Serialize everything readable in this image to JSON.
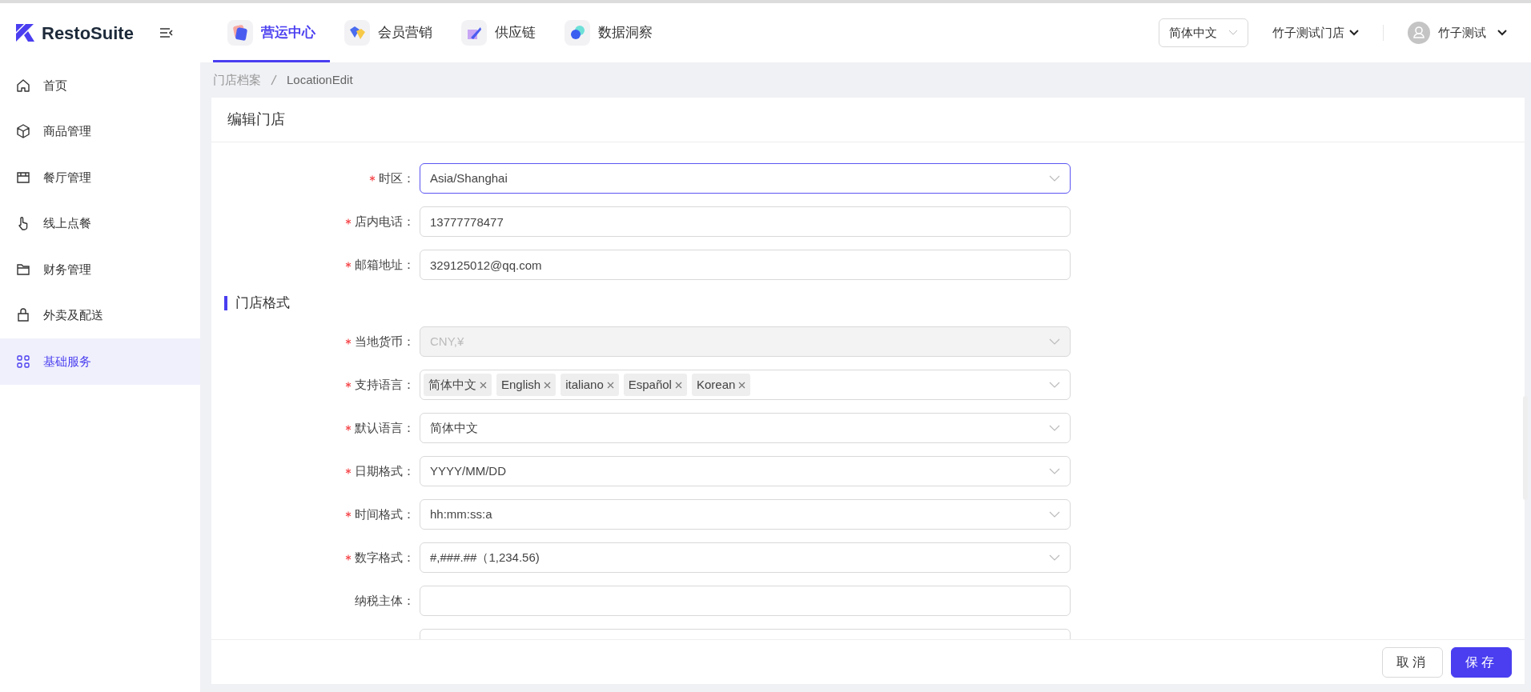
{
  "logo": {
    "text": "RestoSuite"
  },
  "top_tabs": [
    {
      "label": "营运中心",
      "selected": true
    },
    {
      "label": "会员营销",
      "selected": false
    },
    {
      "label": "供应链",
      "selected": false
    },
    {
      "label": "数据洞察",
      "selected": false
    }
  ],
  "language_select": {
    "value": "简体中文"
  },
  "store_menu": {
    "label": "竹子测试门店"
  },
  "user_menu": {
    "label": "竹子测试"
  },
  "sidebar": {
    "items": [
      {
        "label": "首页",
        "selected": false
      },
      {
        "label": "商品管理",
        "selected": false
      },
      {
        "label": "餐厅管理",
        "selected": false
      },
      {
        "label": "线上点餐",
        "selected": false
      },
      {
        "label": "财务管理",
        "selected": false
      },
      {
        "label": "外卖及配送",
        "selected": false
      },
      {
        "label": "基础服务",
        "selected": true
      }
    ]
  },
  "breadcrumb": [
    {
      "label": "门店档案"
    },
    {
      "label": "LocationEdit"
    }
  ],
  "card": {
    "title": "编辑门店",
    "rows": [
      {
        "kind": "select",
        "label": "时区：",
        "required": true,
        "value": "Asia/Shanghai",
        "focused": true,
        "disabled": false
      },
      {
        "kind": "input",
        "label": "店内电话：",
        "required": true,
        "value": "13777778477"
      },
      {
        "kind": "input",
        "label": "邮箱地址：",
        "required": true,
        "value": "329125012@qq.com"
      },
      {
        "kind": "section",
        "label": "门店格式"
      },
      {
        "kind": "select",
        "label": "当地货币：",
        "required": true,
        "value": "CNY,¥",
        "focused": false,
        "disabled": true
      },
      {
        "kind": "tags",
        "label": "支持语言：",
        "required": true,
        "tags": [
          "简体中文",
          "English",
          "italiano",
          "Español",
          "Korean"
        ]
      },
      {
        "kind": "select",
        "label": "默认语言：",
        "required": true,
        "value": "简体中文",
        "focused": false,
        "disabled": false
      },
      {
        "kind": "select",
        "label": "日期格式：",
        "required": true,
        "value": "YYYY/MM/DD",
        "focused": false,
        "disabled": false
      },
      {
        "kind": "select",
        "label": "时间格式：",
        "required": true,
        "value": "hh:mm:ss:a",
        "focused": false,
        "disabled": false
      },
      {
        "kind": "select",
        "label": "数字格式：",
        "required": true,
        "value": "#,###.##（1,234.56)",
        "focused": false,
        "disabled": false
      },
      {
        "kind": "input",
        "label": "纳税主体：",
        "required": false,
        "value": ""
      },
      {
        "kind": "input"
      }
    ],
    "buttons": [
      {
        "label": "取消",
        "primary": false
      },
      {
        "label": "保存",
        "primary": true
      }
    ]
  }
}
